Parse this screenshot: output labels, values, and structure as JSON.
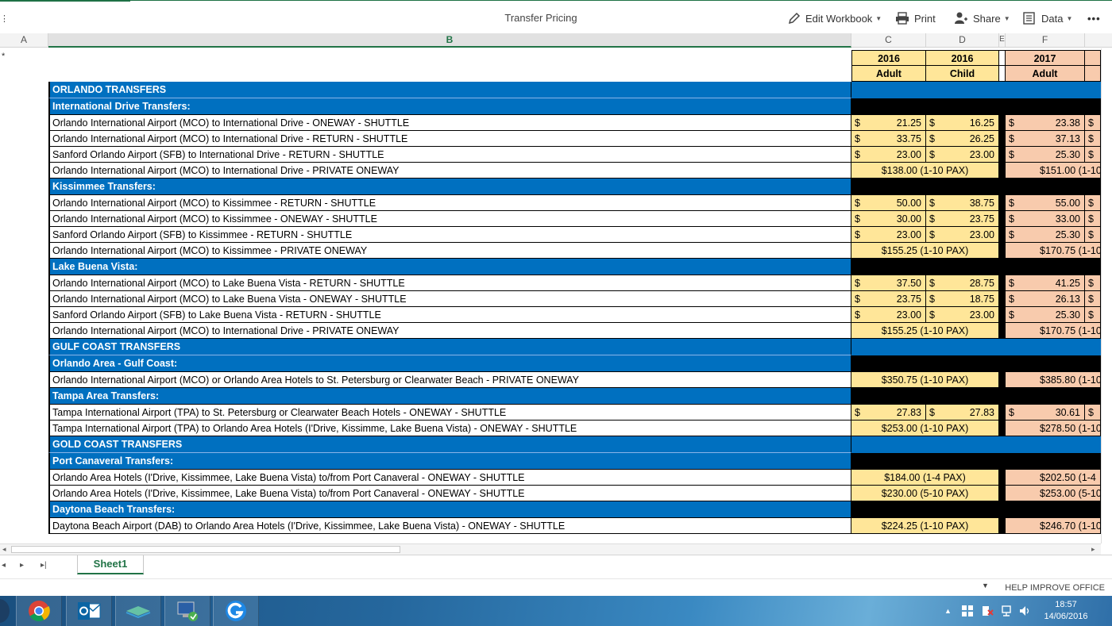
{
  "toolbar": {
    "title": "Transfer Pricing",
    "edit_workbook": "Edit Workbook",
    "print": "Print",
    "share": "Share",
    "data": "Data",
    "more": "•••"
  },
  "columns": [
    "A",
    "B",
    "C",
    "D",
    "E",
    "F"
  ],
  "header": {
    "year_c": "2016",
    "year_d": "2016",
    "year_f": "2017",
    "type_c": "Adult",
    "type_d": "Child",
    "type_f": "Adult"
  },
  "rows": [
    {
      "kind": "section",
      "label": "ORLANDO TRANSFERS"
    },
    {
      "kind": "subsection",
      "label": "International Drive Transfers:"
    },
    {
      "kind": "data",
      "label": "Orlando International Airport (MCO) to International Drive - ONEWAY - SHUTTLE",
      "c": "21.25",
      "d": "16.25",
      "f": "23.38"
    },
    {
      "kind": "data",
      "label": "Orlando International Airport (MCO) to International Drive - RETURN - SHUTTLE",
      "c": "33.75",
      "d": "26.25",
      "f": "37.13"
    },
    {
      "kind": "data",
      "label": "Sanford Orlando Airport (SFB) to International Drive - RETURN - SHUTTLE",
      "c": "23.00",
      "d": "23.00",
      "f": "25.30"
    },
    {
      "kind": "merged",
      "label": "Orlando International Airport (MCO) to International Drive - PRIVATE ONEWAY",
      "cd": "$138.00 (1-10 PAX)",
      "fg": "$151.00 (1-10"
    },
    {
      "kind": "subsection",
      "label": "Kissimmee Transfers:"
    },
    {
      "kind": "data",
      "label": "Orlando International Airport (MCO) to Kissimmee - RETURN - SHUTTLE",
      "c": "50.00",
      "d": "38.75",
      "f": "55.00"
    },
    {
      "kind": "data",
      "label": "Orlando International Airport (MCO) to Kissimmee - ONEWAY - SHUTTLE",
      "c": "30.00",
      "d": "23.75",
      "f": "33.00"
    },
    {
      "kind": "data",
      "label": "Sanford Orlando Airport (SFB) to Kissimmee - RETURN - SHUTTLE",
      "c": "23.00",
      "d": "23.00",
      "f": "25.30"
    },
    {
      "kind": "merged",
      "label": "Orlando International Airport (MCO) to Kissimmee - PRIVATE ONEWAY",
      "cd": "$155.25 (1-10 PAX)",
      "fg": "$170.75 (1-10"
    },
    {
      "kind": "subsection",
      "label": "Lake Buena Vista:"
    },
    {
      "kind": "data",
      "label": "Orlando International Airport (MCO) to Lake Buena Vista - RETURN - SHUTTLE",
      "c": "37.50",
      "d": "28.75",
      "f": "41.25"
    },
    {
      "kind": "data",
      "label": "Orlando International Airport (MCO) to Lake Buena Vista - ONEWAY - SHUTTLE",
      "c": "23.75",
      "d": "18.75",
      "f": "26.13"
    },
    {
      "kind": "data",
      "label": "Sanford Orlando Airport (SFB) to Lake Buena Vista - RETURN - SHUTTLE",
      "c": "23.00",
      "d": "23.00",
      "f": "25.30"
    },
    {
      "kind": "merged",
      "label": "Orlando International Airport (MCO) to International Drive - PRIVATE ONEWAY",
      "cd": "$155.25 (1-10 PAX)",
      "fg": "$170.75 (1-10"
    },
    {
      "kind": "section",
      "label": "GULF COAST TRANSFERS"
    },
    {
      "kind": "subsection",
      "label": "Orlando Area - Gulf Coast:"
    },
    {
      "kind": "merged",
      "label": "Orlando International Airport (MCO) or Orlando Area Hotels to St. Petersburg or Clearwater Beach - PRIVATE ONEWAY",
      "cd": "$350.75 (1-10 PAX)",
      "fg": "$385.80 (1-10"
    },
    {
      "kind": "subsection",
      "label": "Tampa Area Transfers:"
    },
    {
      "kind": "data",
      "label": "Tampa International Airport (TPA) to St. Petersburg or Clearwater Beach Hotels - ONEWAY - SHUTTLE",
      "c": "27.83",
      "d": "27.83",
      "f": "30.61"
    },
    {
      "kind": "merged",
      "label": "Tampa International Airport (TPA) to Orlando Area Hotels (I'Drive, Kissimme, Lake Buena Vista) - ONEWAY - SHUTTLE",
      "cd": "$253.00 (1-10 PAX)",
      "fg": "$278.50 (1-10"
    },
    {
      "kind": "section",
      "label": "GOLD COAST TRANSFERS"
    },
    {
      "kind": "subsection",
      "label": "Port Canaveral Transfers:"
    },
    {
      "kind": "merged",
      "label": "Orlando Area Hotels (I'Drive, Kissimmee, Lake Buena Vista) to/from Port Canaveral - ONEWAY - SHUTTLE",
      "cd": "$184.00 (1-4 PAX)",
      "fg": "$202.50 (1-4"
    },
    {
      "kind": "merged",
      "label": "Orlando Area Hotels (I'Drive, Kissimmee, Lake Buena Vista) to/from Port Canaveral - ONEWAY - SHUTTLE",
      "cd": "$230.00 (5-10 PAX)",
      "fg": "$253.00 (5-10"
    },
    {
      "kind": "subsection",
      "label": "Daytona Beach Transfers:"
    },
    {
      "kind": "merged",
      "label": "Daytona Beach Airport (DAB) to Orlando Area Hotels (I'Drive, Kissimmee, Lake Buena Vista) - ONEWAY - SHUTTLE",
      "cd": "$224.25 (1-10 PAX)",
      "fg": "$246.70 (1-10"
    }
  ],
  "currency_symbol": "$",
  "sheet_tab": "Sheet1",
  "status": {
    "help": "HELP IMPROVE OFFICE"
  },
  "clock": {
    "time": "18:57",
    "date": "14/06/2016"
  },
  "colors": {
    "section_blue": "#0070c0",
    "header_yellow": "#ffe699",
    "header_orange": "#f8cbad",
    "excel_green": "#217346"
  }
}
